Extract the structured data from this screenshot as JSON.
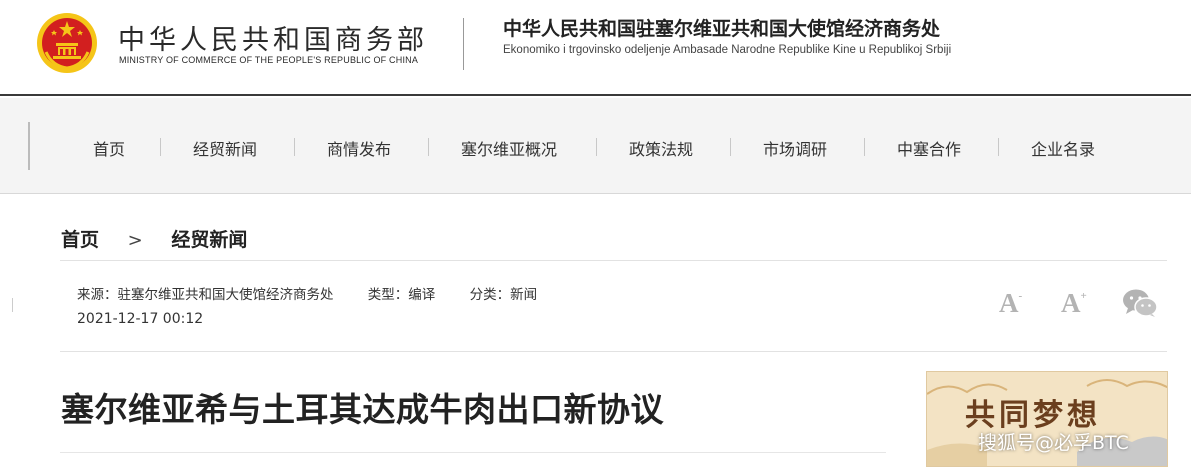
{
  "header": {
    "ministry_cn": "中华人民共和国商务部",
    "ministry_en": "MINISTRY OF COMMERCE OF THE PEOPLE'S REPUBLIC OF CHINA",
    "office_cn": "中华人民共和国驻塞尔维亚共和国大使馆经济商务处",
    "office_en": "Ekonomiko i trgovinsko odeljenje Ambasade Narodne Republike Kine u Republikoj Srbiji",
    "emblem_icon": "national-emblem-icon"
  },
  "nav": {
    "items": [
      {
        "label": "首页"
      },
      {
        "label": "经贸新闻"
      },
      {
        "label": "商情发布"
      },
      {
        "label": "塞尔维亚概况"
      },
      {
        "label": "政策法规"
      },
      {
        "label": "市场调研"
      },
      {
        "label": "中塞合作"
      },
      {
        "label": "企业名录"
      }
    ]
  },
  "breadcrumb": {
    "home": "首页",
    "separator": ">",
    "current": "经贸新闻"
  },
  "meta": {
    "source": "来源：驻塞尔维亚共和国大使馆经济商务处",
    "type": "类型：编译",
    "category": "分类：新闻",
    "date": "2021-12-17 00:12"
  },
  "tools": {
    "font_decrease": "A",
    "font_decrease_sign": "-",
    "font_increase": "A",
    "font_increase_sign": "+",
    "share_icon": "wechat-icon"
  },
  "article": {
    "title": "塞尔维亚希与土耳其达成牛肉出口新协议"
  },
  "banner": {
    "text": "共同梦想"
  },
  "watermark": "搜狐号@必孚BTC",
  "colors": {
    "header_rule": "#3a3a3a",
    "nav_bg": "#f4f4f4",
    "emblem_red": "#d21f1f",
    "emblem_gold": "#f5c518",
    "tool_gray": "#b3b3b3"
  }
}
